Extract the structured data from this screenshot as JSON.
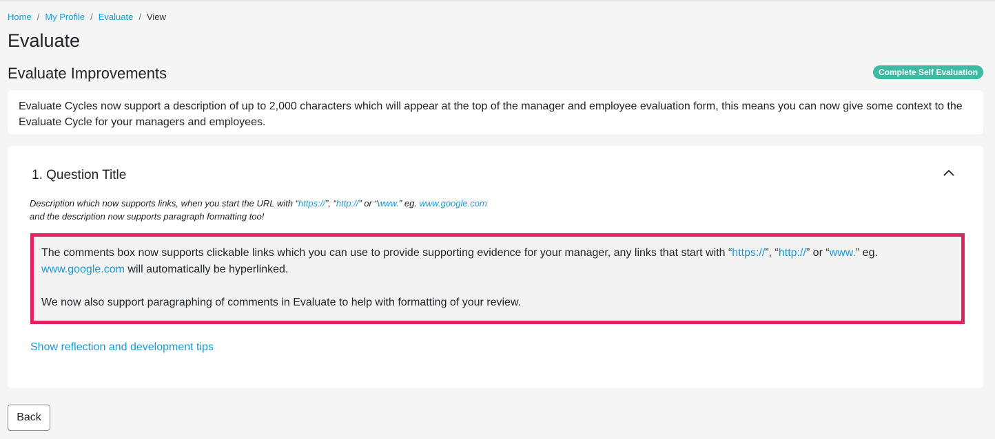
{
  "breadcrumb": {
    "items": [
      "Home",
      "My Profile",
      "Evaluate",
      "View"
    ],
    "separator": "/"
  },
  "page": {
    "title": "Evaluate",
    "section_title": "Evaluate Improvements",
    "status_badge": "Complete Self Evaluation"
  },
  "intro": {
    "text": "Evaluate Cycles now support a description of up to 2,000 characters which will appear at the top of the manager and employee evaluation form, this means you can now give some context to the Evaluate Cycle for your managers and employees."
  },
  "question": {
    "title": "1. Question Title",
    "description": {
      "line1_a": "Description which now supports links, when you start the URL with “",
      "link_https": "https://",
      "mid1": "”, “",
      "link_http": "http://",
      "mid2": "” or “",
      "link_www": "www.",
      "mid3": "” eg. ",
      "link_google": "www.google.com",
      "line2": "and the description now supports paragraph formatting too!"
    },
    "comment": {
      "p1_a": "The comments box now supports clickable links which you can use to provide supporting evidence for your manager, any links that start with “",
      "link_https": "https://",
      "mid1": "”, “",
      "link_http": "http://",
      "mid2": "” or “",
      "link_www": "www.",
      "mid3": "” eg. ",
      "link_google": "www.google.com",
      "p1_b": " will automatically be hyperlinked.",
      "p2": "We now also support paragraphing of comments in Evaluate to help with formatting of your review."
    },
    "tips_link": "Show reflection and development tips"
  },
  "footer": {
    "back_label": "Back"
  },
  "colors": {
    "accent_link": "#1a9ad9",
    "badge": "#3dbca3",
    "highlight_border": "#e3245f"
  }
}
